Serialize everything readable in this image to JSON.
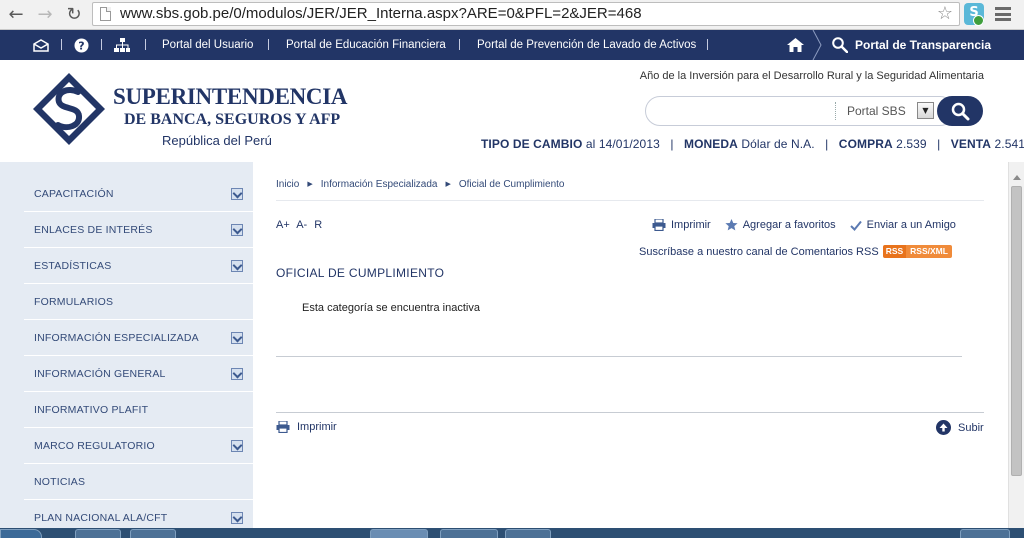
{
  "browser": {
    "url": "www.sbs.gob.pe/0/modulos/JER/JER_Interna.aspx?ARE=0&PFL=2&JER=468"
  },
  "topnav": {
    "items": [
      "Portal del Usuario",
      "Portal de Educación Financiera",
      "Portal de Prevención de Lavado de Activos"
    ],
    "transparency": "Portal de Transparencia",
    "separator": "|"
  },
  "header": {
    "logo": {
      "line1": "SUPERINTENDENCIA",
      "line2": "DE BANCA, SEGUROS Y AFP",
      "line3": "República del Perú"
    },
    "tagline": "Año de la Inversión para el Desarrollo Rural y la Seguridad Alimentaria",
    "search": {
      "value": "",
      "scope": "Portal SBS"
    },
    "exchange": {
      "label": "TIPO DE CAMBIO",
      "date_text": "al 14/01/2013",
      "currency_label": "MONEDA",
      "currency": "Dólar de N.A.",
      "buy_label": "COMPRA",
      "buy": "2.539",
      "sell_label": "VENTA",
      "sell": "2.541"
    }
  },
  "sidebar": {
    "items": [
      {
        "label": "CAPACITACIÓN",
        "expandable": true
      },
      {
        "label": "ENLACES DE INTERÉS",
        "expandable": true
      },
      {
        "label": "ESTADÍSTICAS",
        "expandable": true
      },
      {
        "label": "FORMULARIOS",
        "expandable": false
      },
      {
        "label": "INFORMACIÓN ESPECIALIZADA",
        "expandable": true
      },
      {
        "label": "INFORMACIÓN GENERAL",
        "expandable": true
      },
      {
        "label": "INFORMATIVO PLAFIT",
        "expandable": false
      },
      {
        "label": "MARCO REGULATORIO",
        "expandable": true
      },
      {
        "label": "NOTICIAS",
        "expandable": false
      },
      {
        "label": "PLAN NACIONAL ALA/CFT",
        "expandable": true
      }
    ]
  },
  "content": {
    "breadcrumb": [
      "Inicio",
      "Información Especializada",
      "Oficial de Cumplimiento"
    ],
    "font_controls": {
      "increase": "A+",
      "decrease": "A-",
      "reset": "R"
    },
    "actions": {
      "print": "Imprimir",
      "favorites": "Agregar a favoritos",
      "send": "Enviar a un Amigo"
    },
    "rss": {
      "text": "Suscríbase a nuestro canal de Comentarios RSS",
      "badge_left": "RSS",
      "badge_right": "RSS/XML"
    },
    "title": "OFICIAL DE CUMPLIMIENTO",
    "message": "Esta categoría se encuentra inactiva",
    "footer": {
      "print": "Imprimir",
      "top": "Subir"
    }
  },
  "colors": {
    "brand": "#223566",
    "sidebar_bg": "#e5ebf3",
    "rss": "#e8731c"
  }
}
